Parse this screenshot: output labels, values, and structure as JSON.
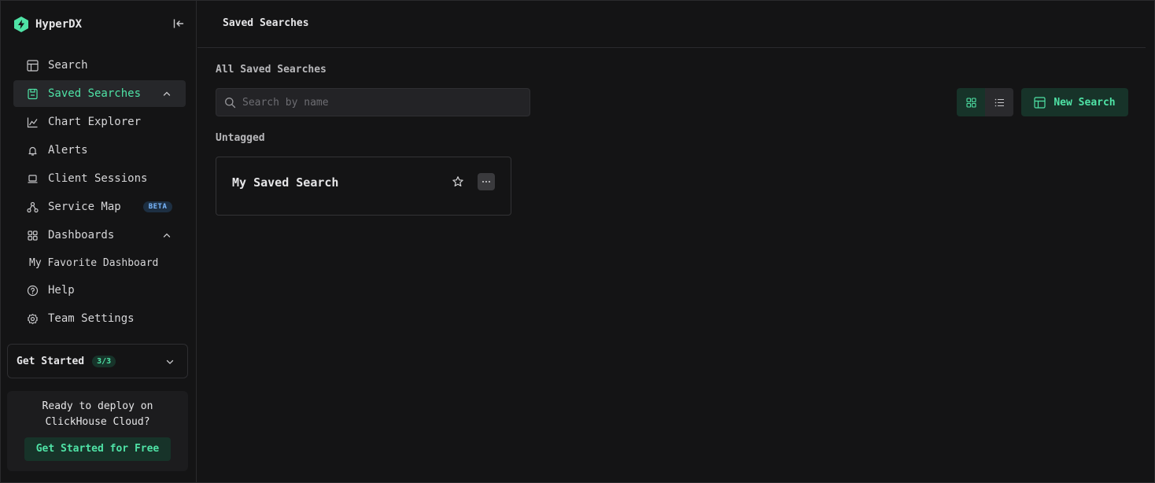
{
  "app": {
    "name": "HyperDX",
    "accent": "#4fe3a6"
  },
  "sidebar": {
    "items": [
      {
        "label": "Search",
        "icon": "table-icon"
      },
      {
        "label": "Saved Searches",
        "icon": "saved-icon",
        "active": true
      },
      {
        "label": "Chart Explorer",
        "icon": "chart-icon"
      },
      {
        "label": "Alerts",
        "icon": "bell-icon"
      },
      {
        "label": "Client Sessions",
        "icon": "laptop-icon"
      },
      {
        "label": "Service Map",
        "icon": "network-icon",
        "badge": "BETA"
      },
      {
        "label": "Dashboards",
        "icon": "grid-icon"
      },
      {
        "label": "Help",
        "icon": "help-icon"
      },
      {
        "label": "Team Settings",
        "icon": "gear-icon"
      }
    ],
    "dashboard_sub": "My Favorite Dashboard",
    "get_started": {
      "label": "Get Started",
      "count": "3/3"
    },
    "promo": {
      "text": "Ready to deploy on ClickHouse Cloud?",
      "button": "Get Started for Free"
    }
  },
  "header": {
    "title": "Saved Searches"
  },
  "main": {
    "section_title": "All Saved Searches",
    "search_placeholder": "Search by name",
    "new_search_label": "New Search",
    "group_label": "Untagged",
    "cards": [
      {
        "title": "My Saved Search"
      }
    ]
  }
}
